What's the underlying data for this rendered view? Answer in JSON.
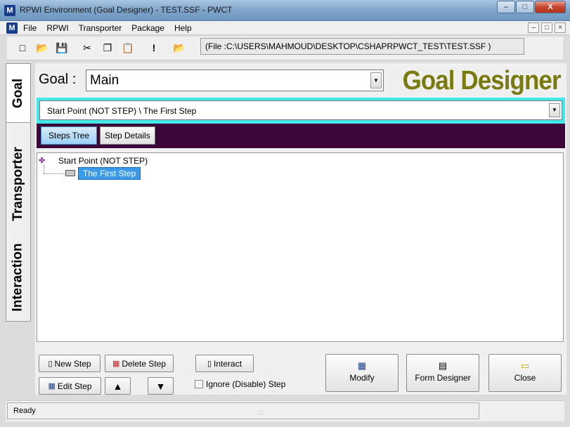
{
  "window": {
    "title": "RPWI Environment (Goal Designer) - TEST.SSF  - PWCT",
    "icon_letter": "M",
    "minimize": "–",
    "maximize": "□",
    "close": "X"
  },
  "menu": {
    "icon_letter": "M",
    "items": [
      "File",
      "RPWI",
      "Transporter",
      "Package",
      "Help"
    ],
    "mdi": [
      "–",
      "□",
      "×"
    ]
  },
  "toolbar": {
    "icons": [
      "new-file-icon",
      "open-folder-icon",
      "save-icon",
      "cut-icon",
      "copy-icon",
      "paste-icon",
      "run-icon",
      "open-project-icon"
    ],
    "glyphs": [
      "□",
      "📂",
      "💾",
      "✂",
      "❐",
      "📋",
      "!",
      "📂"
    ],
    "file_path": "(File :C:\\USERS\\MAHMOUD\\DESKTOP\\CSHAPRPWCT_TEST\\TEST.SSF )"
  },
  "side_tabs": [
    "Goal",
    "Transporter",
    "Interaction"
  ],
  "goal": {
    "label": "Goal :",
    "selected": "Main",
    "designer_title": "Goal Designer"
  },
  "path": {
    "selected": "Start Point (NOT STEP)  \\  The First Step"
  },
  "tabs": {
    "steps_tree": "Steps Tree",
    "step_details": "Step Details"
  },
  "tree": {
    "root": "Start Point (NOT STEP)",
    "child": "The First Step"
  },
  "buttons": {
    "new_step": "New Step",
    "delete_step": "Delete Step",
    "interact": "Interact",
    "edit_step": "Edit Step",
    "up": "▲",
    "down": "▼",
    "ignore": "Ignore (Disable) Step",
    "modify": "Modify",
    "form_designer": "Form Designer",
    "close": "Close"
  },
  "status": {
    "text": "Ready"
  },
  "colors": {
    "designer_title": "#7a7a10",
    "path_bar": "#43e8ea",
    "tab_bar": "#3a0738",
    "selection": "#3a9ae8"
  }
}
